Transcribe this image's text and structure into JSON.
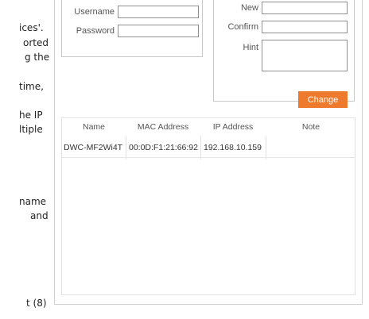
{
  "document": {
    "lines": [
      "ices'.",
      "orted",
      "g the",
      "time,",
      "he IP",
      "ltiple",
      "name",
      "and",
      "t (8)"
    ]
  },
  "login": {
    "username_label": "Username",
    "username_value": "",
    "password_label": "Password",
    "password_value": ""
  },
  "password_change": {
    "new_label": "New",
    "new_value": "",
    "confirm_label": "Confirm",
    "confirm_value": "",
    "hint_label": "Hint",
    "hint_value": "",
    "change_button": "Change",
    "button_color": "#ee7a2e"
  },
  "device_table": {
    "columns": [
      "Name",
      "MAC Address",
      "IP Address",
      "Note"
    ],
    "rows": [
      {
        "name": "DWC-MF2Wi4T",
        "mac": "00:0D:F1:21:66:92",
        "ip": "192.168.10.159",
        "note": ""
      }
    ]
  }
}
